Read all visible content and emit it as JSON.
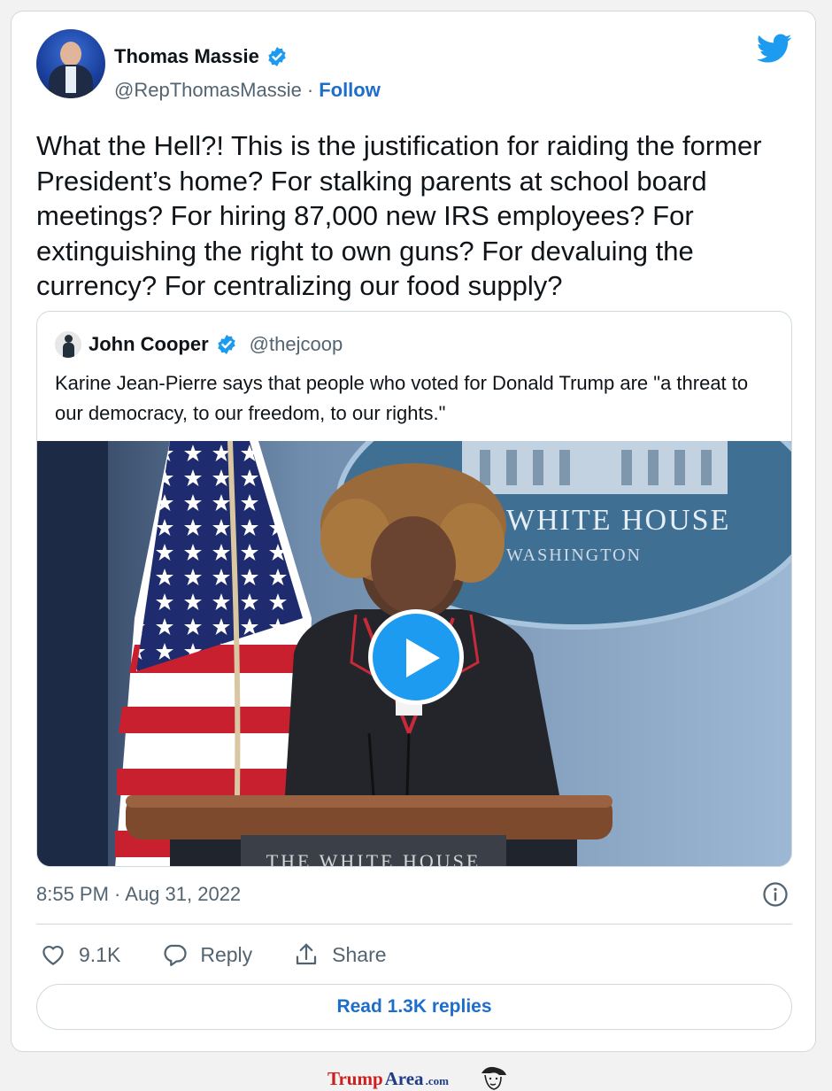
{
  "author": {
    "name": "Thomas Massie",
    "handle": "@RepThomasMassie",
    "separator": "·",
    "follow_label": "Follow"
  },
  "tweet": {
    "text": "What the Hell?! This is the justification for raiding the former President’s home? For stalking parents at school board meetings? For hiring 87,000 new IRS employees? For extinguishing the right to own guns? For devaluing the currency? For centralizing our food supply?",
    "timestamp": "8:55 PM · Aug 31, 2022"
  },
  "quote": {
    "name": "John Cooper",
    "handle": "@thejcoop",
    "text": "Karine Jean-Pierre says that people who voted for Donald Trump are \"a threat to our democracy, to our freedom, to our rights.\"",
    "video": {
      "seal_line1": "WHITE HOUSE",
      "seal_line2": "WASHINGTON",
      "podium_text": "THE WHITE HOUSE"
    }
  },
  "actions": {
    "like_count": "9.1K",
    "reply_label": "Reply",
    "share_label": "Share",
    "read_replies_label": "Read 1.3K replies"
  },
  "watermark": {
    "part1": "Trump",
    "part2": "Area",
    "part3": ".com"
  },
  "colors": {
    "accent": "#1d9bf0",
    "link": "#1d6ecb",
    "muted": "#536471",
    "border": "#cfd9de"
  },
  "icons": [
    "verified-badge-icon",
    "twitter-bird-icon",
    "play-icon",
    "info-icon",
    "heart-icon",
    "reply-icon",
    "share-icon"
  ]
}
